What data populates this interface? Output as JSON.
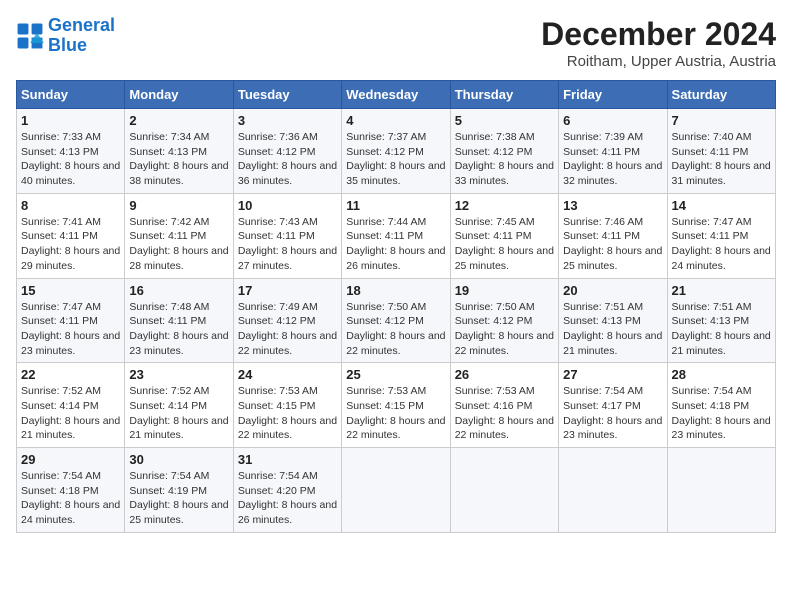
{
  "header": {
    "logo_line1": "General",
    "logo_line2": "Blue",
    "month": "December 2024",
    "location": "Roitham, Upper Austria, Austria"
  },
  "days_of_week": [
    "Sunday",
    "Monday",
    "Tuesday",
    "Wednesday",
    "Thursday",
    "Friday",
    "Saturday"
  ],
  "weeks": [
    [
      {
        "day": "1",
        "sunrise": "Sunrise: 7:33 AM",
        "sunset": "Sunset: 4:13 PM",
        "daylight": "Daylight: 8 hours and 40 minutes."
      },
      {
        "day": "2",
        "sunrise": "Sunrise: 7:34 AM",
        "sunset": "Sunset: 4:13 PM",
        "daylight": "Daylight: 8 hours and 38 minutes."
      },
      {
        "day": "3",
        "sunrise": "Sunrise: 7:36 AM",
        "sunset": "Sunset: 4:12 PM",
        "daylight": "Daylight: 8 hours and 36 minutes."
      },
      {
        "day": "4",
        "sunrise": "Sunrise: 7:37 AM",
        "sunset": "Sunset: 4:12 PM",
        "daylight": "Daylight: 8 hours and 35 minutes."
      },
      {
        "day": "5",
        "sunrise": "Sunrise: 7:38 AM",
        "sunset": "Sunset: 4:12 PM",
        "daylight": "Daylight: 8 hours and 33 minutes."
      },
      {
        "day": "6",
        "sunrise": "Sunrise: 7:39 AM",
        "sunset": "Sunset: 4:11 PM",
        "daylight": "Daylight: 8 hours and 32 minutes."
      },
      {
        "day": "7",
        "sunrise": "Sunrise: 7:40 AM",
        "sunset": "Sunset: 4:11 PM",
        "daylight": "Daylight: 8 hours and 31 minutes."
      }
    ],
    [
      {
        "day": "8",
        "sunrise": "Sunrise: 7:41 AM",
        "sunset": "Sunset: 4:11 PM",
        "daylight": "Daylight: 8 hours and 29 minutes."
      },
      {
        "day": "9",
        "sunrise": "Sunrise: 7:42 AM",
        "sunset": "Sunset: 4:11 PM",
        "daylight": "Daylight: 8 hours and 28 minutes."
      },
      {
        "day": "10",
        "sunrise": "Sunrise: 7:43 AM",
        "sunset": "Sunset: 4:11 PM",
        "daylight": "Daylight: 8 hours and 27 minutes."
      },
      {
        "day": "11",
        "sunrise": "Sunrise: 7:44 AM",
        "sunset": "Sunset: 4:11 PM",
        "daylight": "Daylight: 8 hours and 26 minutes."
      },
      {
        "day": "12",
        "sunrise": "Sunrise: 7:45 AM",
        "sunset": "Sunset: 4:11 PM",
        "daylight": "Daylight: 8 hours and 25 minutes."
      },
      {
        "day": "13",
        "sunrise": "Sunrise: 7:46 AM",
        "sunset": "Sunset: 4:11 PM",
        "daylight": "Daylight: 8 hours and 25 minutes."
      },
      {
        "day": "14",
        "sunrise": "Sunrise: 7:47 AM",
        "sunset": "Sunset: 4:11 PM",
        "daylight": "Daylight: 8 hours and 24 minutes."
      }
    ],
    [
      {
        "day": "15",
        "sunrise": "Sunrise: 7:47 AM",
        "sunset": "Sunset: 4:11 PM",
        "daylight": "Daylight: 8 hours and 23 minutes."
      },
      {
        "day": "16",
        "sunrise": "Sunrise: 7:48 AM",
        "sunset": "Sunset: 4:11 PM",
        "daylight": "Daylight: 8 hours and 23 minutes."
      },
      {
        "day": "17",
        "sunrise": "Sunrise: 7:49 AM",
        "sunset": "Sunset: 4:12 PM",
        "daylight": "Daylight: 8 hours and 22 minutes."
      },
      {
        "day": "18",
        "sunrise": "Sunrise: 7:50 AM",
        "sunset": "Sunset: 4:12 PM",
        "daylight": "Daylight: 8 hours and 22 minutes."
      },
      {
        "day": "19",
        "sunrise": "Sunrise: 7:50 AM",
        "sunset": "Sunset: 4:12 PM",
        "daylight": "Daylight: 8 hours and 22 minutes."
      },
      {
        "day": "20",
        "sunrise": "Sunrise: 7:51 AM",
        "sunset": "Sunset: 4:13 PM",
        "daylight": "Daylight: 8 hours and 21 minutes."
      },
      {
        "day": "21",
        "sunrise": "Sunrise: 7:51 AM",
        "sunset": "Sunset: 4:13 PM",
        "daylight": "Daylight: 8 hours and 21 minutes."
      }
    ],
    [
      {
        "day": "22",
        "sunrise": "Sunrise: 7:52 AM",
        "sunset": "Sunset: 4:14 PM",
        "daylight": "Daylight: 8 hours and 21 minutes."
      },
      {
        "day": "23",
        "sunrise": "Sunrise: 7:52 AM",
        "sunset": "Sunset: 4:14 PM",
        "daylight": "Daylight: 8 hours and 21 minutes."
      },
      {
        "day": "24",
        "sunrise": "Sunrise: 7:53 AM",
        "sunset": "Sunset: 4:15 PM",
        "daylight": "Daylight: 8 hours and 22 minutes."
      },
      {
        "day": "25",
        "sunrise": "Sunrise: 7:53 AM",
        "sunset": "Sunset: 4:15 PM",
        "daylight": "Daylight: 8 hours and 22 minutes."
      },
      {
        "day": "26",
        "sunrise": "Sunrise: 7:53 AM",
        "sunset": "Sunset: 4:16 PM",
        "daylight": "Daylight: 8 hours and 22 minutes."
      },
      {
        "day": "27",
        "sunrise": "Sunrise: 7:54 AM",
        "sunset": "Sunset: 4:17 PM",
        "daylight": "Daylight: 8 hours and 23 minutes."
      },
      {
        "day": "28",
        "sunrise": "Sunrise: 7:54 AM",
        "sunset": "Sunset: 4:18 PM",
        "daylight": "Daylight: 8 hours and 23 minutes."
      }
    ],
    [
      {
        "day": "29",
        "sunrise": "Sunrise: 7:54 AM",
        "sunset": "Sunset: 4:18 PM",
        "daylight": "Daylight: 8 hours and 24 minutes."
      },
      {
        "day": "30",
        "sunrise": "Sunrise: 7:54 AM",
        "sunset": "Sunset: 4:19 PM",
        "daylight": "Daylight: 8 hours and 25 minutes."
      },
      {
        "day": "31",
        "sunrise": "Sunrise: 7:54 AM",
        "sunset": "Sunset: 4:20 PM",
        "daylight": "Daylight: 8 hours and 26 minutes."
      },
      null,
      null,
      null,
      null
    ]
  ]
}
